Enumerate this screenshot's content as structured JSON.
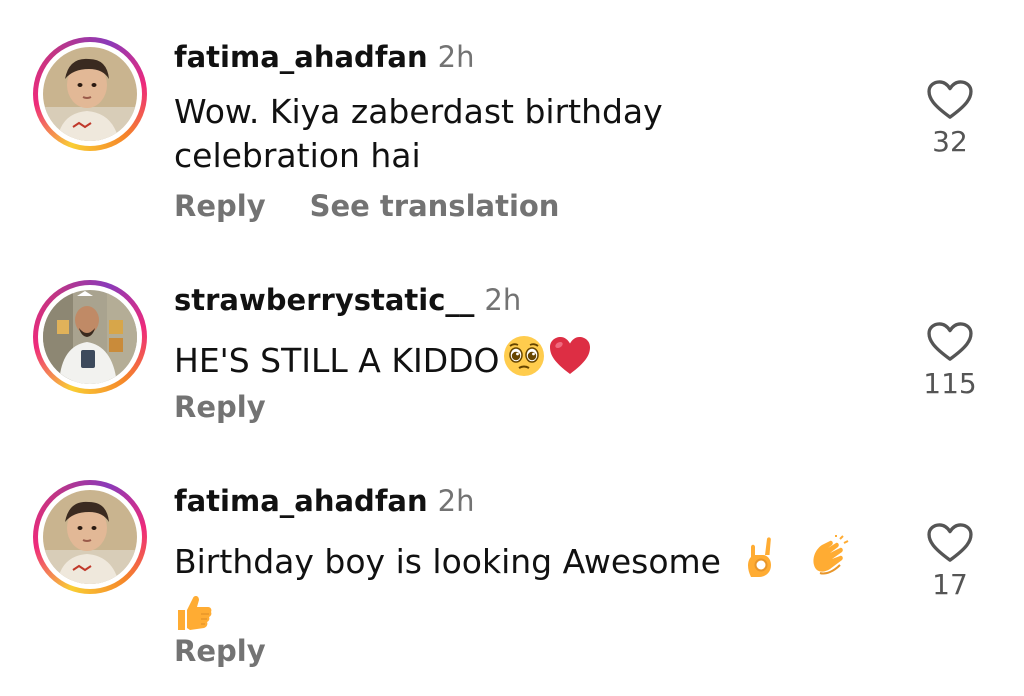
{
  "comments": [
    {
      "username": "fatima_ahadfan",
      "time": "2h",
      "text_line1": "Wow. Kiya zaberdast birthday",
      "text_line2": "celebration hai",
      "reply_label": "Reply",
      "translate_label": "See translation",
      "likes": "32",
      "avatar": "child-portrait"
    },
    {
      "username": "strawberrystatic__",
      "time": "2h",
      "text": "HE'S STILL A KIDDO",
      "emojis": [
        "pleading-face-emoji",
        "red-heart-emoji"
      ],
      "reply_label": "Reply",
      "likes": "115",
      "avatar": "party-portrait"
    },
    {
      "username": "fatima_ahadfan",
      "time": "2h",
      "text": "Birthday boy is looking Awesome",
      "emojis": [
        "ok-hand-emoji",
        "clapping-hands-emoji",
        "thumbs-up-emoji"
      ],
      "reply_label": "Reply",
      "likes": "17",
      "avatar": "child-portrait"
    }
  ],
  "colors": {
    "primary_text": "#111111",
    "secondary_text": "#737373",
    "story_ring": [
      "#f9ce34",
      "#ee2a7b",
      "#8a3ab9"
    ]
  }
}
